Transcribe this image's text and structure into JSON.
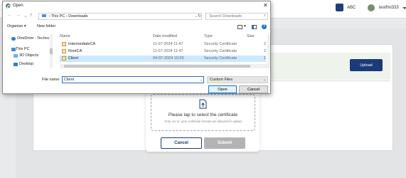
{
  "app": {
    "org_label": "ABC",
    "user_name": "testfmi333",
    "upload_label": "Upload"
  },
  "cert_modal": {
    "tap_text": "Please tap to select the certificate",
    "hint_text": "Only .cer or .pem certificate formats are allowed for upload",
    "cancel_label": "Cancel",
    "submit_label": "Submit"
  },
  "dialog": {
    "title": "Open",
    "close_glyph": "✕",
    "nav": {
      "back": "←",
      "forward": "→",
      "recent": "⌄",
      "up": "↑"
    },
    "address": [
      "This PC",
      "›",
      "Downloads"
    ],
    "address_sep_start": "›",
    "search_placeholder": "Search Downloads",
    "toolbar": {
      "organise": "Organise ▾",
      "new_folder": "New folder",
      "view": "▾"
    },
    "help_glyph": "?",
    "nav_pane": [
      {
        "label": "OneDrive - Technc"
      },
      {
        "label": "This PC"
      },
      {
        "label": "3D Objects"
      },
      {
        "label": "Desktop"
      }
    ],
    "columns": {
      "name": "Name",
      "date": "Date modified",
      "type": "Type",
      "size": "Size"
    },
    "files": [
      {
        "name": "IntermediateCA",
        "date": "11-07-2024 11:47",
        "type": "Security Certificate",
        "size": "2"
      },
      {
        "name": "RootCA",
        "date": "11-07-2024 11:47",
        "type": "Security Certificate",
        "size": "2"
      },
      {
        "name": "Client",
        "date": "04-07-2024 10:29",
        "type": "Security Certificate",
        "size": "1"
      }
    ],
    "file_name_label": "File name:",
    "file_name_value": "Client",
    "file_type": "Custom Files",
    "open_label": "Open",
    "cancel_label": "Cancel"
  },
  "colors": {
    "brand": "#1a3a7a",
    "selection": "#cce8ff",
    "submit_disabled": "#b3b3b3"
  }
}
